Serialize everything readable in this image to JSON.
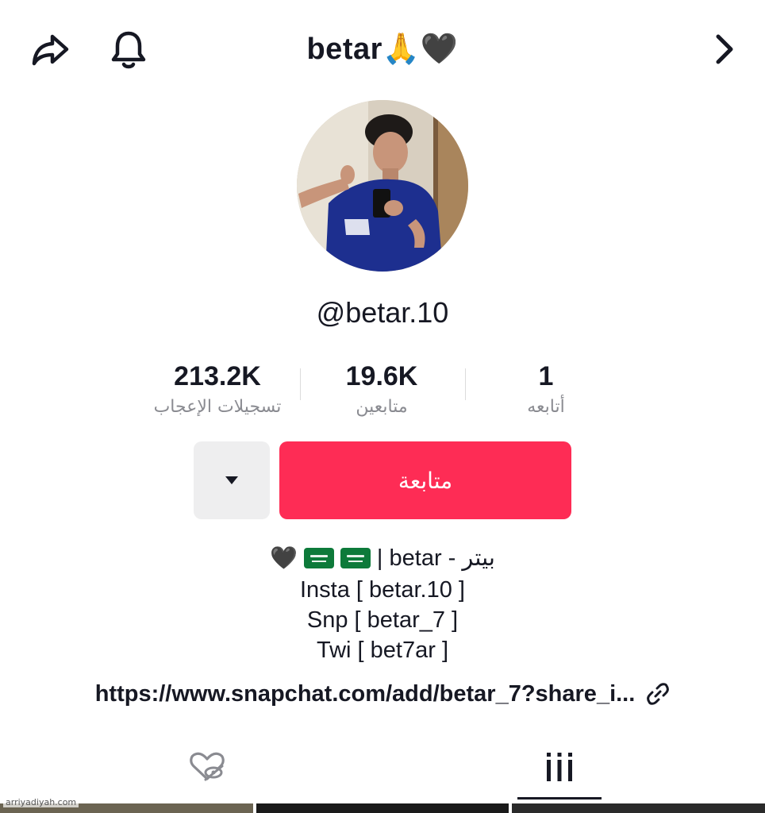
{
  "header": {
    "title": "betar🙏🖤",
    "share_icon": "share-arrow-icon",
    "bell_icon": "bell-icon",
    "next_icon": "chevron-right-icon"
  },
  "profile": {
    "handle": "@betar.10"
  },
  "stats": [
    {
      "value": "213.2K",
      "label": "تسجيلات الإعجاب"
    },
    {
      "value": "19.6K",
      "label": "متابعين"
    },
    {
      "value": "1",
      "label": "أتابعه"
    }
  ],
  "actions": {
    "follow_label": "متابعة",
    "more_icon": "caret-down-icon"
  },
  "bio": {
    "line1_text": "بيتر - betar |",
    "line1_hearts": "🖤",
    "line2": "Insta [ betar.10 ]",
    "line3": "Snp [ betar_7 ]",
    "line4": "Twi [ bet7ar ]",
    "link": "https://www.snapchat.com/add/betar_7?share_i..."
  },
  "tabs": [
    {
      "icon": "liked-videos-hidden-icon"
    },
    {
      "icon": "videos-grid-icon",
      "active": true
    }
  ],
  "watermark": "arriyadiyah.com",
  "colors": {
    "follow": "#fe2c55",
    "text": "#161823",
    "muted": "#8a8b91"
  }
}
